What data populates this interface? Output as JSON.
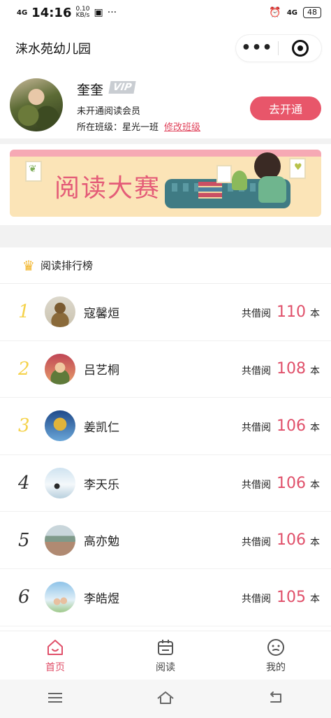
{
  "status_bar": {
    "signal": "4G",
    "time": "14:16",
    "net_speed": "0.10",
    "net_unit": "KB/s",
    "notification_icon": "app-notification-icon",
    "more": "···",
    "alarm_icon": "alarm-clock-icon",
    "signal_right": "4G",
    "battery": "48"
  },
  "header": {
    "title": "涞水苑幼儿园",
    "more_icon": "more-dots-icon",
    "close_icon": "target-close-icon"
  },
  "profile": {
    "name": "奎奎",
    "vip_badge": "VIP",
    "member_status": "未开通阅读会员",
    "class_label": "所在班级：星光一班",
    "change_class": "修改班级",
    "open_button": "去开通"
  },
  "banner": {
    "title": "阅读大赛"
  },
  "ranking": {
    "title": "阅读排行榜",
    "borrow_label": "共借阅",
    "unit": "本",
    "rows": [
      {
        "rank": "1",
        "name": "寇馨烜",
        "count": "110"
      },
      {
        "rank": "2",
        "name": "吕艺桐",
        "count": "108"
      },
      {
        "rank": "3",
        "name": "姜凯仁",
        "count": "106"
      },
      {
        "rank": "4",
        "name": "李天乐",
        "count": "106"
      },
      {
        "rank": "5",
        "name": "高亦勉",
        "count": "106"
      },
      {
        "rank": "6",
        "name": "李皓煜",
        "count": "105"
      }
    ]
  },
  "tabs": [
    {
      "label": "首页",
      "icon": "home-icon",
      "active": true
    },
    {
      "label": "阅读",
      "icon": "calendar-icon",
      "active": false
    },
    {
      "label": "我的",
      "icon": "face-icon",
      "active": false
    }
  ],
  "colors": {
    "accent": "#e0506a",
    "button": "#e8566a",
    "top_rank": "#f5d24a",
    "banner_bg": "#fbe4b7"
  }
}
